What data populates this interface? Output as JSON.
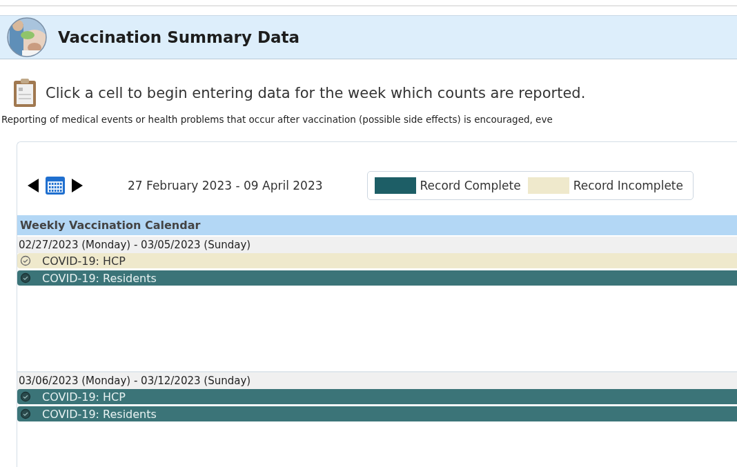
{
  "header": {
    "title": "Vaccination Summary Data"
  },
  "instruction": "Click a cell to begin entering data for the week which counts are reported.",
  "note": "Reporting of medical events or health problems that occur after vaccination (possible side effects) is encouraged, eve",
  "toolbar": {
    "date_range": "27 February 2023  -  09 April 2023"
  },
  "legend": [
    {
      "label": "Record Complete",
      "color": "#1d5e66"
    },
    {
      "label": "Record Incomplete",
      "color": "#efe9cc"
    }
  ],
  "calendar": {
    "title": "Weekly Vaccination Calendar",
    "weeks": [
      {
        "range": "02/27/2023 (Monday) - 03/05/2023 (Sunday)",
        "records": [
          {
            "label": "COVID-19: HCP",
            "complete": false
          },
          {
            "label": "COVID-19: Residents",
            "complete": true
          }
        ]
      },
      {
        "range": "03/06/2023 (Monday) - 03/12/2023 (Sunday)",
        "records": [
          {
            "label": "COVID-19: HCP",
            "complete": true
          },
          {
            "label": "COVID-19: Residents",
            "complete": true
          }
        ]
      }
    ]
  }
}
